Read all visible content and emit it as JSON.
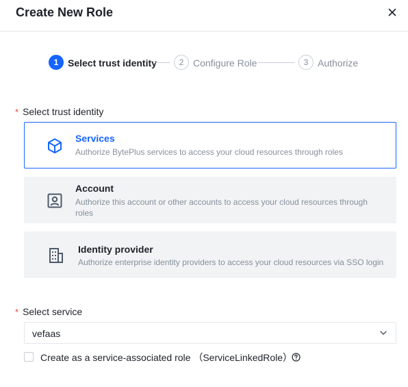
{
  "modal": {
    "title": "Create New Role"
  },
  "steps": [
    {
      "number": "1",
      "label": "Select trust identity",
      "state": "active"
    },
    {
      "number": "2",
      "label": "Configure Role",
      "state": "inactive"
    },
    {
      "number": "3",
      "label": "Authorize",
      "state": "inactive"
    }
  ],
  "trust_identity": {
    "label": "Select trust identity",
    "required_mark": "*",
    "options": [
      {
        "title": "Services",
        "description": "Authorize BytePlus services to access your cloud resources through roles",
        "icon": "cube-icon",
        "selected": true
      },
      {
        "title": "Account",
        "description": "Authorize this account or other accounts to access your cloud resources through roles",
        "icon": "account-card-icon",
        "selected": false
      },
      {
        "title": "Identity provider",
        "description": "Authorize enterprise identity providers to access your cloud resources via SSO login",
        "icon": "building-icon",
        "selected": false
      }
    ]
  },
  "service": {
    "label": "Select service",
    "required_mark": "*",
    "value": "vefaas"
  },
  "service_linked": {
    "label": "Create as a service-associated role （ServiceLinkedRole）",
    "checked": false
  },
  "colors": {
    "primary": "#1664ff",
    "required": "#f53f3f",
    "muted": "#86909c"
  }
}
